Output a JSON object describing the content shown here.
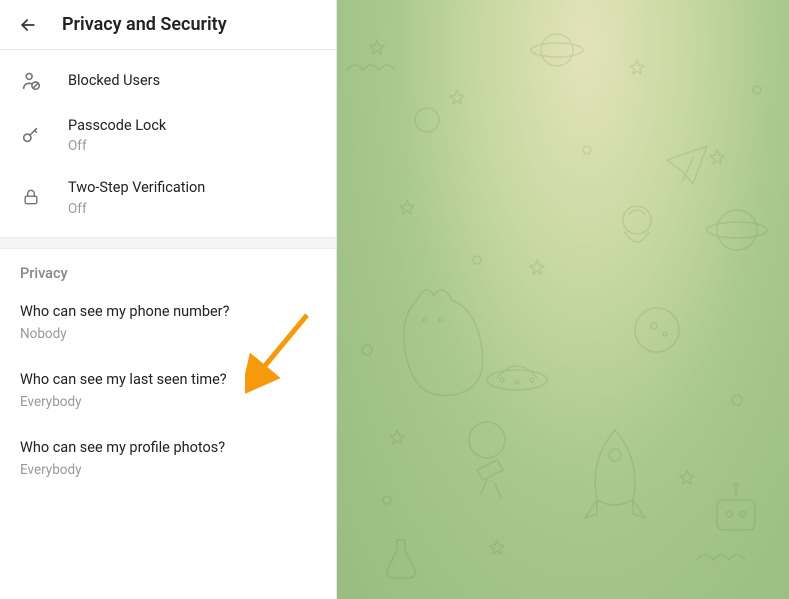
{
  "header": {
    "title": "Privacy and Security"
  },
  "security": {
    "items": [
      {
        "label": "Blocked Users",
        "sub": ""
      },
      {
        "label": "Passcode Lock",
        "sub": "Off"
      },
      {
        "label": "Two-Step Verification",
        "sub": "Off"
      }
    ]
  },
  "privacy": {
    "section_label": "Privacy",
    "items": [
      {
        "label": "Who can see my phone number?",
        "sub": "Nobody"
      },
      {
        "label": "Who can see my last seen time?",
        "sub": "Everybody"
      },
      {
        "label": "Who can see my profile photos?",
        "sub": "Everybody"
      }
    ]
  },
  "annotation": {
    "arrow_color": "#f59a0c"
  }
}
